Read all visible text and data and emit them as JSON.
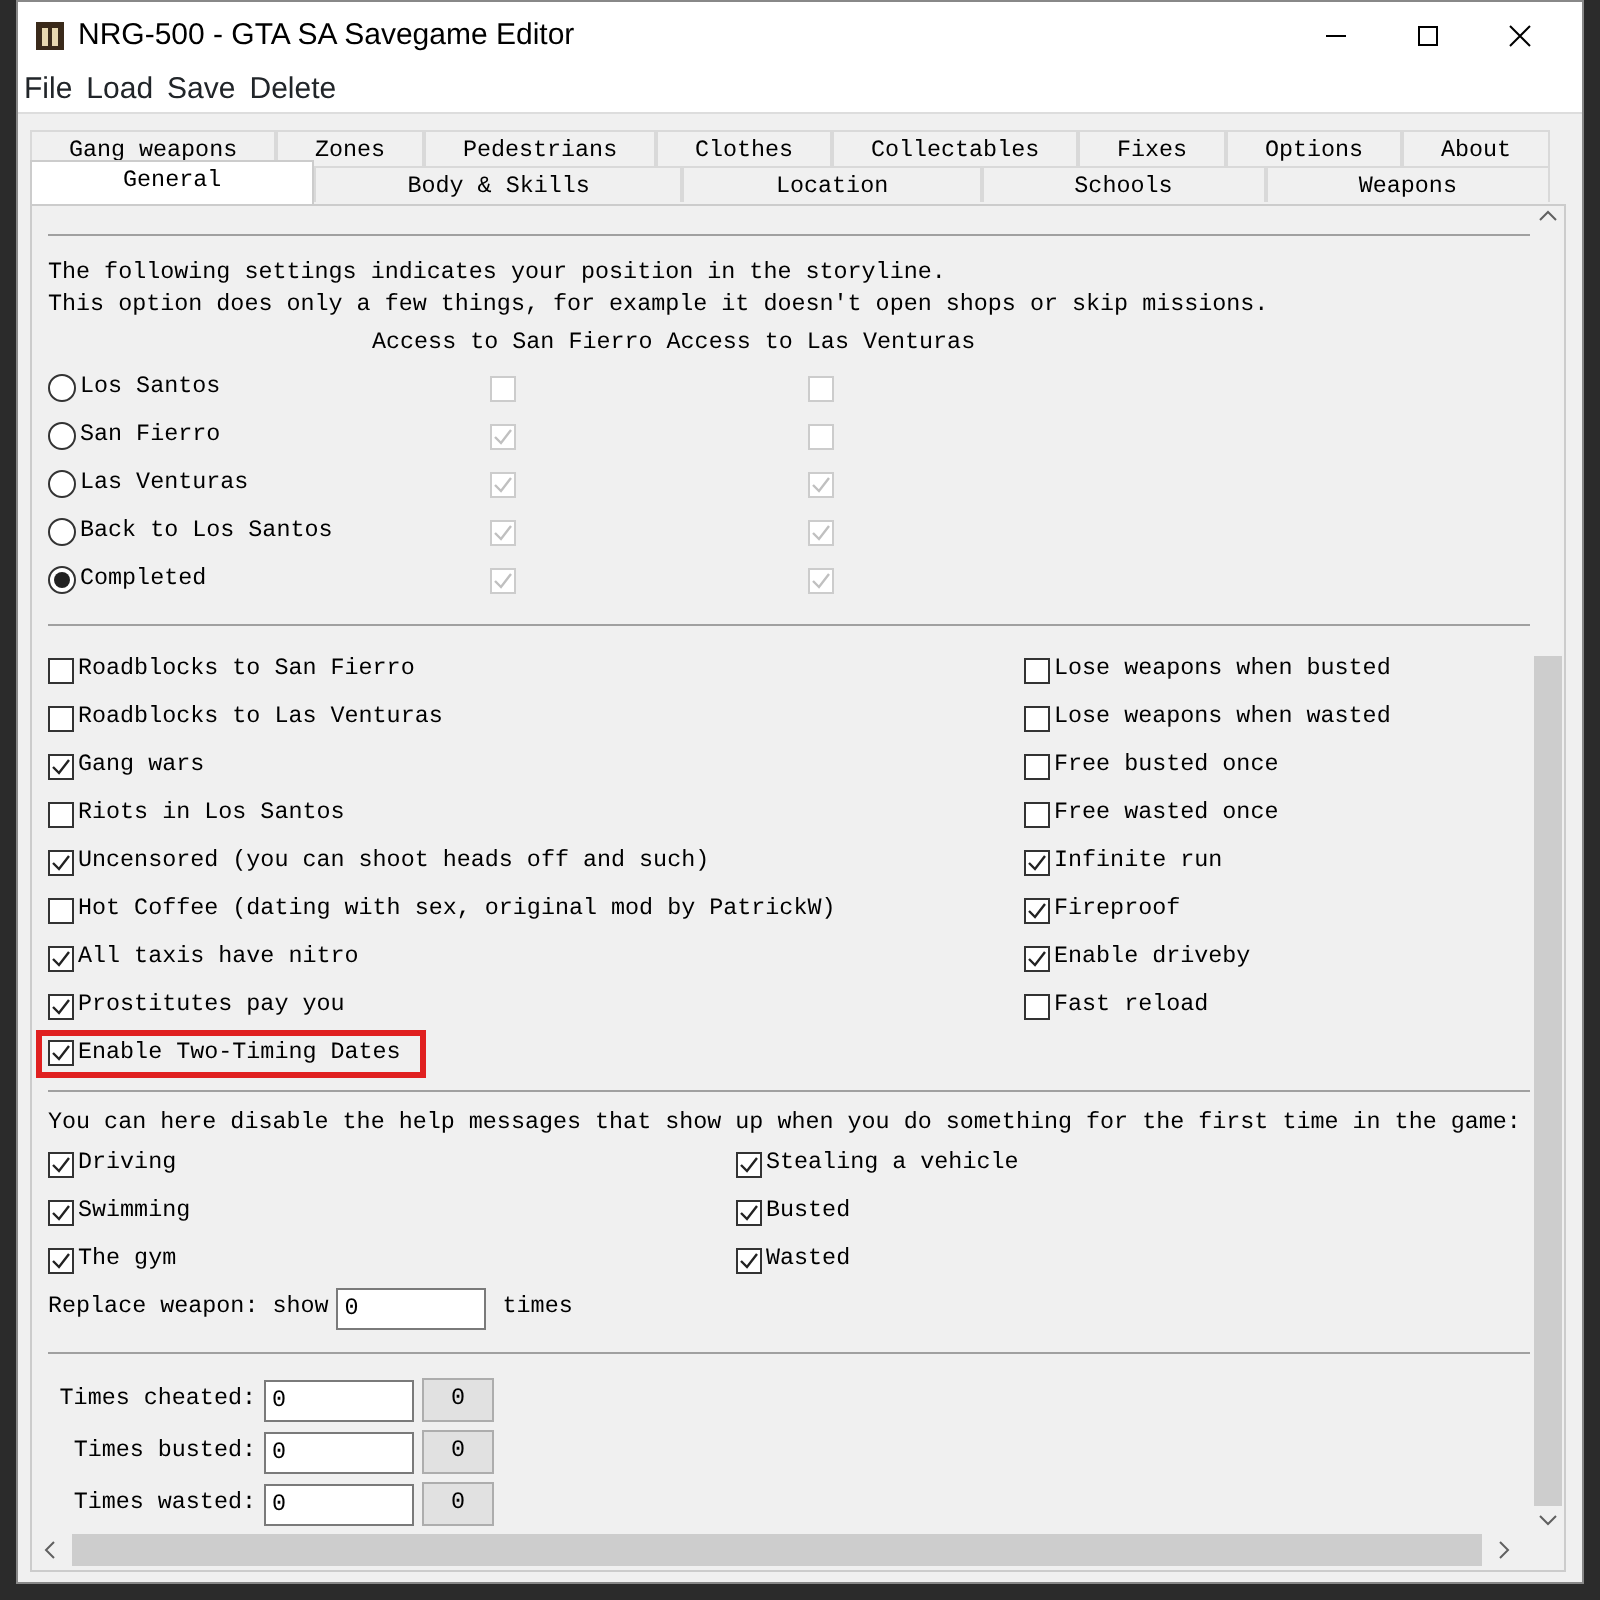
{
  "window": {
    "title": "NRG-500 - GTA SA Savegame Editor"
  },
  "menu": [
    "File",
    "Load",
    "Save",
    "Delete"
  ],
  "tab_rows": [
    [
      {
        "label": "Gang weapons",
        "selected": false
      },
      {
        "label": "Zones",
        "selected": false
      },
      {
        "label": "Pedestrians",
        "selected": false
      },
      {
        "label": "Clothes",
        "selected": false
      },
      {
        "label": "Collectables",
        "selected": false
      },
      {
        "label": "Fixes",
        "selected": false
      },
      {
        "label": "Options",
        "selected": false
      },
      {
        "label": "About",
        "selected": false
      }
    ],
    [
      {
        "label": "General",
        "selected": true
      },
      {
        "label": "Body & Skills",
        "selected": false
      },
      {
        "label": "Location",
        "selected": false
      },
      {
        "label": "Schools",
        "selected": false
      },
      {
        "label": "Weapons",
        "selected": false
      }
    ]
  ],
  "storyline": {
    "intro": [
      "The following settings indicates your position in the storyline.",
      "This option does only a few things, for example it doesn't open shops or skip missions."
    ],
    "columns": [
      "Access to San Fierro",
      "Access to Las Venturas"
    ],
    "rows": [
      {
        "label": "Los Santos",
        "selected": false,
        "access": [
          {
            "checked": false,
            "disabled": true
          },
          {
            "checked": false,
            "disabled": true
          }
        ]
      },
      {
        "label": "San Fierro",
        "selected": false,
        "access": [
          {
            "checked": true,
            "disabled": true
          },
          {
            "checked": false,
            "disabled": true
          }
        ]
      },
      {
        "label": "Las Venturas",
        "selected": false,
        "access": [
          {
            "checked": true,
            "disabled": true
          },
          {
            "checked": true,
            "disabled": true
          }
        ]
      },
      {
        "label": "Back to Los Santos",
        "selected": false,
        "access": [
          {
            "checked": true,
            "disabled": true
          },
          {
            "checked": true,
            "disabled": true
          }
        ]
      },
      {
        "label": "Completed",
        "selected": true,
        "access": [
          {
            "checked": true,
            "disabled": true
          },
          {
            "checked": true,
            "disabled": true
          }
        ]
      }
    ]
  },
  "options": {
    "left": [
      {
        "label": "Roadblocks to San Fierro",
        "checked": false
      },
      {
        "label": "Roadblocks to Las Venturas",
        "checked": false
      },
      {
        "label": "Gang wars",
        "checked": true
      },
      {
        "label": "Riots in Los Santos",
        "checked": false
      },
      {
        "label": "Uncensored (you can shoot heads off and such)",
        "checked": true
      },
      {
        "label": "Hot Coffee (dating with sex, original mod by PatrickW)",
        "checked": false
      },
      {
        "label": "All taxis have nitro",
        "checked": true
      },
      {
        "label": "Prostitutes pay you",
        "checked": true
      },
      {
        "label": "Enable Two-Timing Dates",
        "checked": true,
        "highlighted": true
      }
    ],
    "right": [
      {
        "label": "Lose weapons when busted",
        "checked": false
      },
      {
        "label": "Lose weapons when wasted",
        "checked": false
      },
      {
        "label": "Free busted once",
        "checked": false
      },
      {
        "label": "Free wasted once",
        "checked": false
      },
      {
        "label": "Infinite run",
        "checked": true
      },
      {
        "label": "Fireproof",
        "checked": true
      },
      {
        "label": "Enable driveby",
        "checked": true
      },
      {
        "label": "Fast reload",
        "checked": false
      }
    ]
  },
  "help": {
    "text": "You can here disable the help messages that show up when you do something for the first time in the game:",
    "left": [
      {
        "label": "Driving",
        "checked": true
      },
      {
        "label": "Swimming",
        "checked": true
      },
      {
        "label": "The gym",
        "checked": true
      }
    ],
    "right": [
      {
        "label": "Stealing a vehicle",
        "checked": true
      },
      {
        "label": "Busted",
        "checked": true
      },
      {
        "label": "Wasted",
        "checked": true
      }
    ],
    "replace_weapon": {
      "label": "Replace weapon: show",
      "value": "0",
      "suffix": "times"
    }
  },
  "counters": [
    {
      "label": "Times cheated:",
      "value": "0",
      "button": "0"
    },
    {
      "label": "Times busted:",
      "value": "0",
      "button": "0"
    },
    {
      "label": "Times wasted:",
      "value": "0",
      "button": "0"
    }
  ]
}
